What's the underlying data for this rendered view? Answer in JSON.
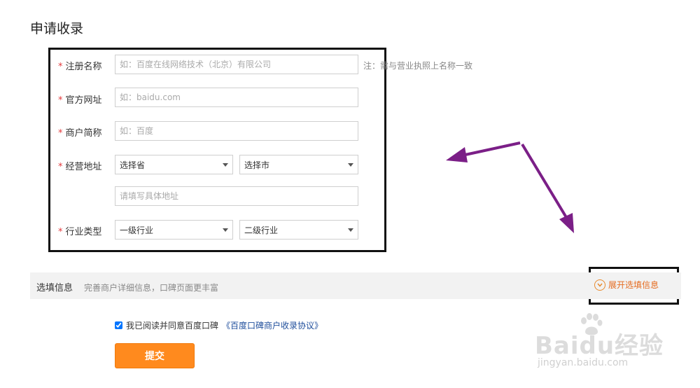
{
  "page": {
    "title": "申请收录"
  },
  "form": {
    "required_mark": "*",
    "name_label": "注册名称",
    "name_placeholder": "如：百度在线网络技术（北京）有限公司",
    "name_hint": "注：需与营业执照上名称一致",
    "website_label": "官方网址",
    "website_placeholder": "如：baidu.com",
    "short_label": "商户简称",
    "short_placeholder": "如：百度",
    "address_label": "经营地址",
    "province_value": "选择省",
    "city_value": "选择市",
    "detail_placeholder": "请填写具体地址",
    "industry_label": "行业类型",
    "industry1_value": "一级行业",
    "industry2_value": "二级行业"
  },
  "optional": {
    "title": "选填信息",
    "desc": "完善商户详细信息，口碑页面更丰富",
    "expand_label": "展开选填信息"
  },
  "agreement": {
    "checked": true,
    "text": "我已阅读并同意百度口碑",
    "link": "《百度口碑商户收录协议》"
  },
  "submit_label": "提交",
  "watermark": {
    "main": "Baidu经验",
    "sub": "jingyan.baidu.com"
  },
  "colors": {
    "accent": "#ff8a1e",
    "required": "#e4393c",
    "link": "#1f4e9c",
    "arrow": "#7b1f87"
  }
}
